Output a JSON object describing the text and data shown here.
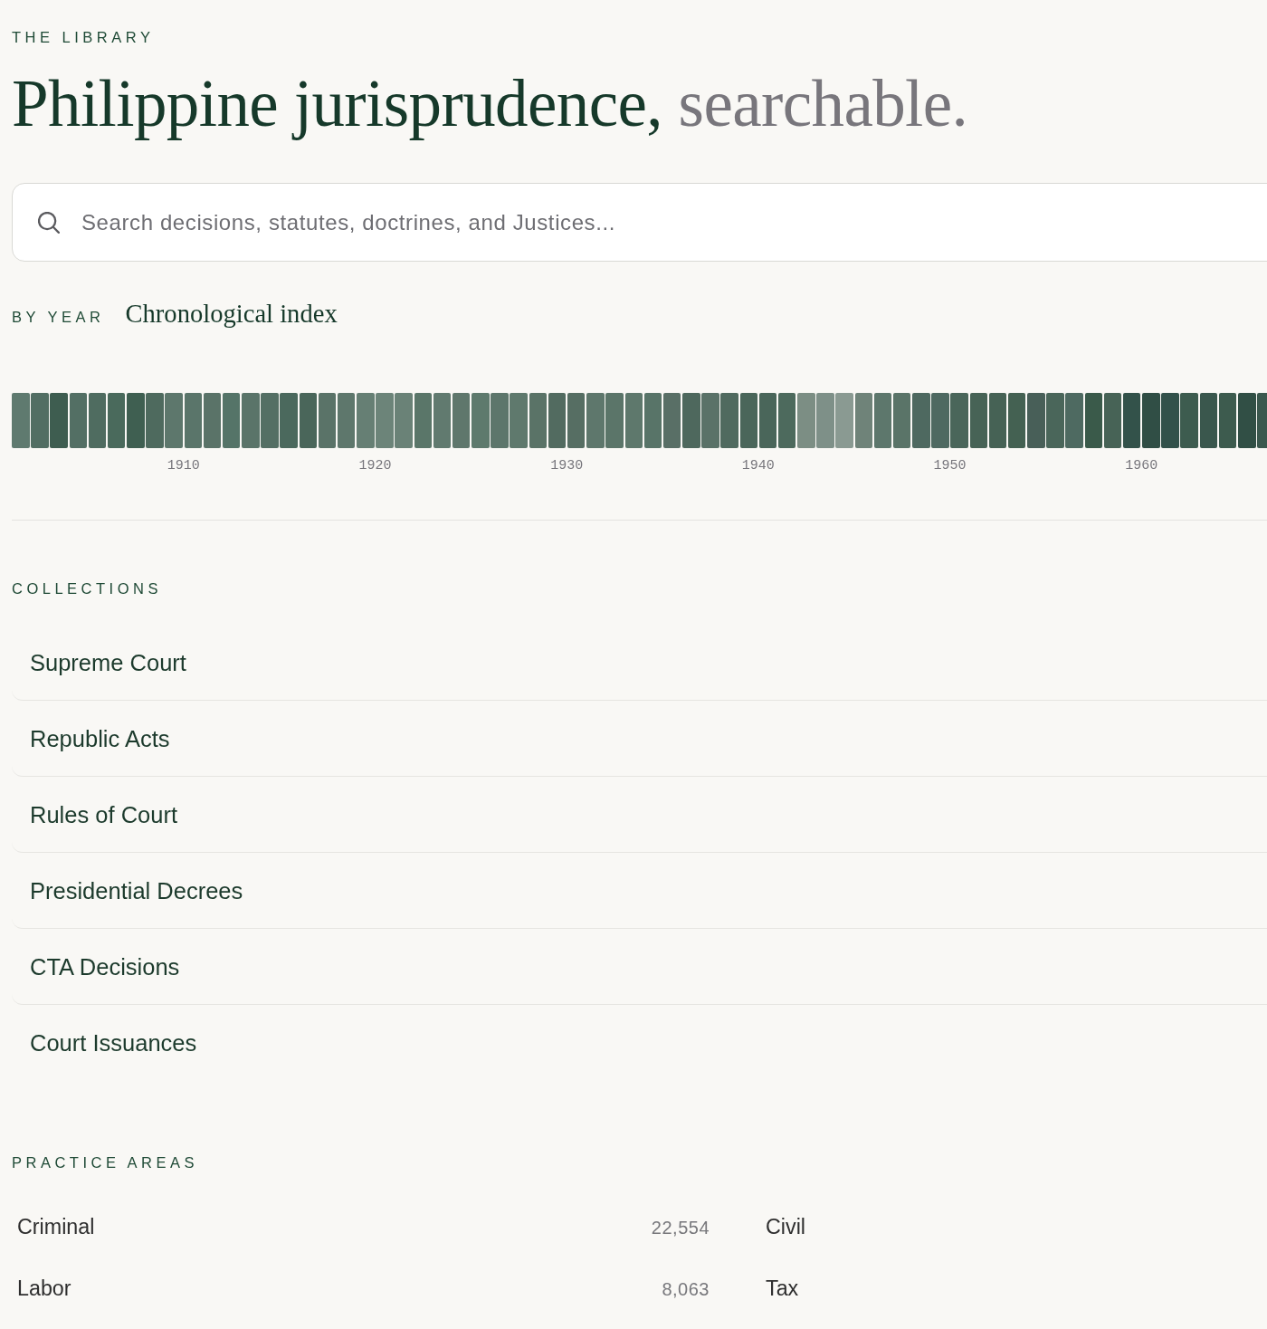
{
  "eyebrow": "THE LIBRARY",
  "title": {
    "main": "Philippine jurisprudence,",
    "accent": "searchable."
  },
  "search": {
    "placeholder": "Search decisions, statutes, doctrines, and Justices..."
  },
  "by_year": {
    "label": "BY YEAR",
    "title": "Chronological index",
    "year_labels": [
      "1910",
      "1920",
      "1930",
      "1940",
      "1950",
      "1960"
    ]
  },
  "collections": {
    "label": "COLLECTIONS",
    "items": [
      "Supreme Court",
      "Republic Acts",
      "Rules of Court",
      "Presidential Decrees",
      "CTA Decisions",
      "Court Issuances"
    ]
  },
  "practice_areas": {
    "label": "PRACTICE AREAS",
    "items": [
      {
        "name": "Criminal",
        "count": "22,554"
      },
      {
        "name": "Civil"
      },
      {
        "name": "Labor",
        "count": "8,063"
      },
      {
        "name": "Tax"
      }
    ]
  }
}
